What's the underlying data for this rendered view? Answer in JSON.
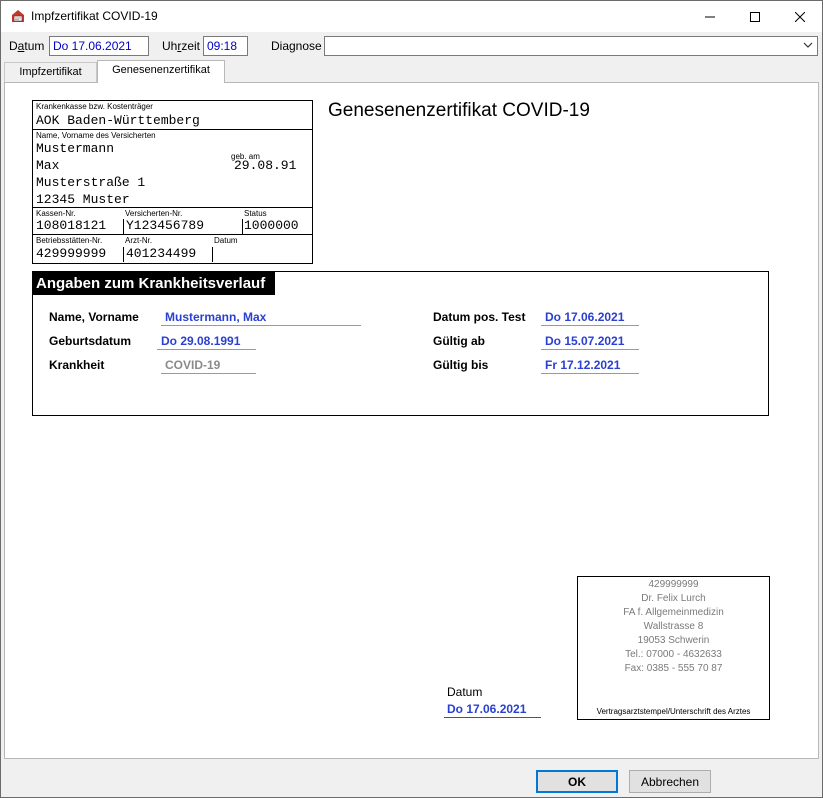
{
  "window": {
    "title": "Impfzertifikat COVID-19"
  },
  "header": {
    "datum_label_pre": "D",
    "datum_label_hot": "a",
    "datum_label_post": "tum",
    "datum_value": "Do 17.06.2021",
    "uhrzeit_label_pre": "Uh",
    "uhrzeit_label_hot": "r",
    "uhrzeit_label_post": "zeit",
    "uhrzeit_value": "09:18",
    "diagnose_label": "Diagnose",
    "diagnose_value": ""
  },
  "tabs": [
    {
      "label": "Impfzertifikat"
    },
    {
      "label": "Genesenenzertifikat"
    }
  ],
  "insurance": {
    "kasse_caption": "Krankenkasse bzw. Kostenträger",
    "kasse": "AOK Baden-Württemberg",
    "name_caption": "Name, Vorname des Versicherten",
    "lastname": "Mustermann",
    "firstname": "Max",
    "dob_caption": "geb. am",
    "dob": "29.08.91",
    "street": "Musterstraße 1",
    "city": "12345 Muster",
    "kassen_nr_caption": "Kassen-Nr.",
    "kassen_nr": "108018121",
    "versicherten_nr_caption": "Versicherten-Nr.",
    "versicherten_nr": "Y123456789",
    "status_caption": "Status",
    "status": "1000000",
    "bsnr_caption": "Betriebsstätten-Nr.",
    "bsnr": "429999999",
    "arzt_nr_caption": "Arzt-Nr.",
    "arzt_nr": "401234499",
    "datum_caption": "Datum",
    "datum": ""
  },
  "document_title": "Genesenenzertifikat COVID-19",
  "course": {
    "heading": "Angaben zum Krankheitsverlauf",
    "name_label": "Name, Vorname",
    "name_value": "Mustermann, Max",
    "geburtsdatum_label": "Geburtsdatum",
    "geburtsdatum_value": "Do 29.08.1991",
    "krankheit_label": "Krankheit",
    "krankheit_value": "COVID-19",
    "test_label": "Datum pos. Test",
    "test_value": "Do 17.06.2021",
    "gueltig_ab_label": "Gültig ab",
    "gueltig_ab_value": "Do 15.07.2021",
    "gueltig_bis_label": "Gültig bis",
    "gueltig_bis_value": "Fr 17.12.2021"
  },
  "stamp": {
    "lines": [
      "429999999",
      "Dr. Felix Lurch",
      "FA f. Allgemeinmedizin",
      "Wallstrasse 8",
      "19053 Schwerin",
      "Tel.: 07000 - 4632633",
      "Fax: 0385 - 555 70 87"
    ],
    "footer": "Vertragsarztstempel/Unterschrift des Arztes"
  },
  "signature": {
    "label": "Datum",
    "value": "Do 17.06.2021"
  },
  "buttons": {
    "ok": "OK",
    "cancel": "Abbrechen"
  },
  "icons": {
    "app": "certificate-app-icon",
    "minimize": "minimize-icon",
    "maximize": "maximize-icon",
    "close": "close-icon",
    "dropdown": "chevron-down-icon"
  },
  "colors": {
    "value_blue": "#2a40d0",
    "field_blue": "#0000c8",
    "accent": "#0078d7"
  }
}
